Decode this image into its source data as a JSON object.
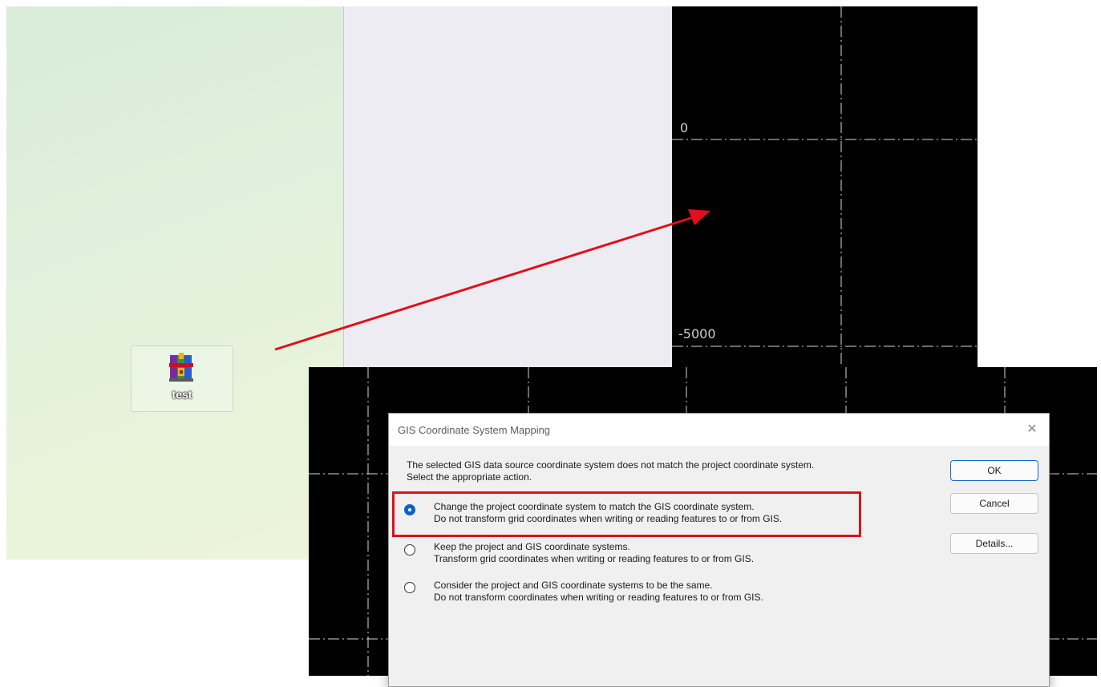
{
  "desktop": {
    "icon_label": "test",
    "icon_name": "winrar-archive-icon"
  },
  "canvas": {
    "label_top": "0",
    "label_mid": "-5000"
  },
  "dialog": {
    "title": "GIS Coordinate System Mapping",
    "message_line1": "The selected GIS data source coordinate system does not match the project coordinate system.",
    "message_line2": "Select the appropriate action.",
    "options": [
      {
        "line1": "Change the project coordinate system to match the GIS coordinate system.",
        "line2": "Do not transform grid coordinates when writing or reading features to or from GIS.",
        "selected": true
      },
      {
        "line1": "Keep the project and GIS coordinate systems.",
        "line2": "Transform grid coordinates when writing or reading features to or from GIS.",
        "selected": false
      },
      {
        "line1": "Consider the project and GIS coordinate systems to be the same.",
        "line2": "Do not transform coordinates when writing or reading features to or from GIS.",
        "selected": false
      }
    ],
    "buttons": {
      "ok": "OK",
      "cancel": "Cancel",
      "details": "Details..."
    }
  },
  "colors": {
    "annotation_red": "#e0101a",
    "accent_blue": "#0f62c4"
  }
}
